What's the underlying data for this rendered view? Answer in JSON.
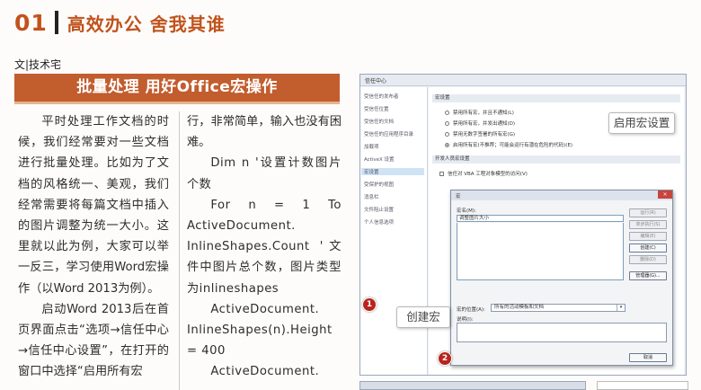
{
  "header": {
    "section_number": "01",
    "title": "高效办公 舍我其谁"
  },
  "article": {
    "byline": "文|技术宅",
    "title": "批量处理 用好Office宏操作",
    "col1": [
      "平时处理工作文档的时候，我们经常要对一些文档进行批量处理。比如为了文档的风格统一、美观，我们经常需要将每篇文档中插入的图片调整为统一大小。这里就以此为例，大家可以举一反三，学习使用Word宏操作（以Word 2013为例）。",
      "启动Word 2013后在首页界面点击“选项→信任中心→信任中心设置”，在打开的窗口中选择“启用所有宏"
    ],
    "col2_intro": "行，非常简单，输入也没有困难。",
    "code1": "Dim n '设置计数图片个数",
    "code2a": "For n = 1 To",
    "code2b": "ActiveDocument.",
    "code2c": "InlineShapes.Count '文件中图片总个数，图片类型为inlineshapes",
    "code3a": "ActiveDocument.",
    "code3b": "InlineShapes(n).Height = 400",
    "code4a": "ActiveDocument."
  },
  "screenshot": {
    "window_title": "信任中心",
    "nav_items": [
      "受信任的发布者",
      "受信任位置",
      "受信任的文档",
      "受信任的应用程序目录",
      "加载项",
      "ActiveX 设置",
      "宏设置",
      "受保护的视图",
      "消息栏",
      "文件阻止设置",
      "个人信息选项"
    ],
    "macro_settings_header": "宏设置",
    "options": [
      "禁用所有宏，并且不通知(L)",
      "禁用所有宏，并发出通知(D)",
      "禁用无数字签署的所有宏(G)",
      "启用所有宏(不推荐；可能会运行有潜在危险的代码)(E)"
    ],
    "dev_header": "开发人员宏设置",
    "vba_checkbox": "信任对 VBA 工程对象模型的访问(V)",
    "macro_dialog": {
      "title": "宏",
      "name_label": "宏名(M):",
      "name_value": "调整图片大小",
      "buttons": [
        "运行(R)",
        "单步执行(S)",
        "编辑(E)",
        "创建(C)",
        "删除(D)",
        "管理器(G)..."
      ],
      "location_label": "宏的位置(A):",
      "location_value": "所有的活动模板和文档",
      "description_label": "说明(I):",
      "cancel": "取消",
      "close": "×"
    },
    "callout_enable": "启用宏设置",
    "callout_create": "创建宏",
    "badge1": "1",
    "badge2": "2"
  }
}
